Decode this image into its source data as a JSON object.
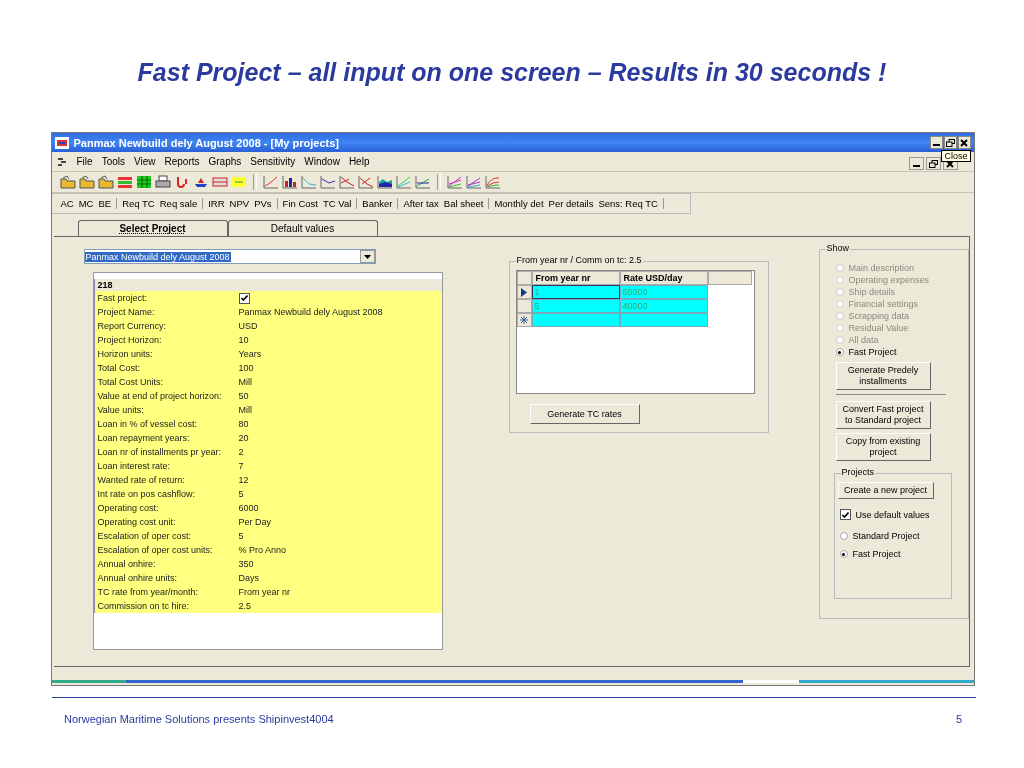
{
  "slide": {
    "title": "Fast Project – all input on one screen – Results in 30 seconds !",
    "footer": "Norwegian Maritime Solutions presents Shipinvest4004",
    "page_number": "5"
  },
  "window": {
    "title": "Panmax Newbuild dely August 2008 - [My projects]",
    "tooltip": "Close"
  },
  "menu": [
    "File",
    "Tools",
    "View",
    "Reports",
    "Graphs",
    "Sensitivity",
    "Window",
    "Help"
  ],
  "text_toolbar": [
    [
      "AC",
      "MC",
      "BE"
    ],
    [
      "Req TC",
      "Req sale"
    ],
    [
      "IRR",
      "NPV",
      "PVs"
    ],
    [
      "Fin Cost",
      "TC Val"
    ],
    [
      "Banker"
    ],
    [
      "After tax",
      "Bal sheet"
    ],
    [
      "Monthly det",
      "Per details",
      "Sens: Req TC"
    ]
  ],
  "tabs": [
    {
      "label": "Select Project",
      "selected": true
    },
    {
      "label": "Default values",
      "selected": false
    }
  ],
  "project_dropdown": {
    "value": "Panmax Newbuild dely August 2008"
  },
  "properties": {
    "header": "218",
    "rows": [
      {
        "label": "Fast project:",
        "kind": "checkbox",
        "checked": true
      },
      {
        "label": "Project Name:",
        "kind": "text",
        "value": "Panmax Newbuild dely August 2008"
      },
      {
        "label": "Report Currency:",
        "kind": "text",
        "value": "USD"
      },
      {
        "label": "Project Horizon:",
        "kind": "text",
        "value": "10"
      },
      {
        "label": "Horizon units:",
        "kind": "text",
        "value": "Years"
      },
      {
        "label": "Total Cost:",
        "kind": "text",
        "value": "100"
      },
      {
        "label": "Total Cost Units:",
        "kind": "text",
        "value": "Mill"
      },
      {
        "label": "Value at end of project horizon:",
        "kind": "text",
        "value": "50"
      },
      {
        "label": "Value units:",
        "kind": "text",
        "value": "Mill"
      },
      {
        "label": "Loan in % of vessel cost:",
        "kind": "text",
        "value": "80"
      },
      {
        "label": "Loan repayment years:",
        "kind": "text",
        "value": "20"
      },
      {
        "label": "Loan nr of installments pr year:",
        "kind": "text",
        "value": "2"
      },
      {
        "label": "Loan interest rate:",
        "kind": "text",
        "value": "7"
      },
      {
        "label": "Wanted rate of return:",
        "kind": "text",
        "value": "12"
      },
      {
        "label": "Int rate on pos cashflow:",
        "kind": "text",
        "value": "5"
      },
      {
        "label": "Operating cost:",
        "kind": "text",
        "value": "6000"
      },
      {
        "label": "Operating cost unit:",
        "kind": "text",
        "value": "Per Day"
      },
      {
        "label": "Escalation of oper cost:",
        "kind": "text",
        "value": "5"
      },
      {
        "label": "Escalation of oper cost units:",
        "kind": "text",
        "value": "% Pro Anno"
      },
      {
        "label": "Annual onhire:",
        "kind": "text",
        "value": "350"
      },
      {
        "label": "Annual onhire units:",
        "kind": "text",
        "value": "Days"
      },
      {
        "label": "TC rate from year/month:",
        "kind": "text",
        "value": "From year nr"
      },
      {
        "label": "Commission on tc hire:",
        "kind": "text",
        "value": "2.5"
      }
    ]
  },
  "tc_rates": {
    "title": "From year nr / Comm on tc: 2.5",
    "columns": [
      "From year nr",
      "Rate USD/day"
    ],
    "rows": [
      {
        "cells": [
          "1",
          "50000"
        ],
        "selected": true
      },
      {
        "cells": [
          "5",
          "40000"
        ],
        "selected": false
      }
    ],
    "button": "Generate TC rates"
  },
  "show": {
    "title": "Show",
    "options": [
      {
        "label": "Main description",
        "selected": false,
        "disabled": true
      },
      {
        "label": "Operating expenses",
        "selected": false,
        "disabled": true
      },
      {
        "label": "Ship details",
        "selected": false,
        "disabled": true
      },
      {
        "label": "Financial settings",
        "selected": false,
        "disabled": true
      },
      {
        "label": "Scrapping data",
        "selected": false,
        "disabled": true
      },
      {
        "label": "Residual Value",
        "selected": false,
        "disabled": true
      },
      {
        "label": "All data",
        "selected": false,
        "disabled": true
      },
      {
        "label": "Fast Project",
        "selected": true,
        "disabled": false
      }
    ],
    "buttons": [
      "Generate Predely\ninstallments",
      "Convert Fast project\nto Standard project",
      "Copy from existing\nproject"
    ],
    "projects": {
      "title": "Projects",
      "button": "Create a new project",
      "use_defaults": {
        "label": "Use default values",
        "checked": true
      },
      "types": [
        {
          "label": "Standard Project",
          "selected": false
        },
        {
          "label": "Fast Project",
          "selected": true
        }
      ]
    }
  }
}
